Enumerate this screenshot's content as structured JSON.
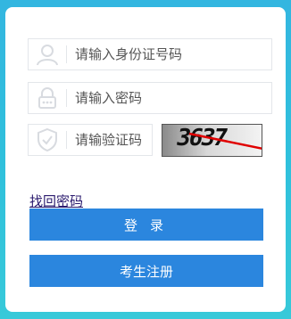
{
  "form": {
    "username": {
      "placeholder": "请输入身份证号码",
      "value": ""
    },
    "password": {
      "placeholder": "请输入密码",
      "value": ""
    },
    "captcha": {
      "placeholder": "请输验证码",
      "value": "",
      "image_text": "3637"
    },
    "find_password_label": "找回密码",
    "login_label": "登录",
    "register_label": "考生注册"
  },
  "icons": {
    "username": "user-icon",
    "password": "lock-icon",
    "captcha": "shield-icon"
  },
  "colors": {
    "background": "#33b6e0",
    "primary_button": "#2b86de",
    "link": "#2a1a6e"
  }
}
